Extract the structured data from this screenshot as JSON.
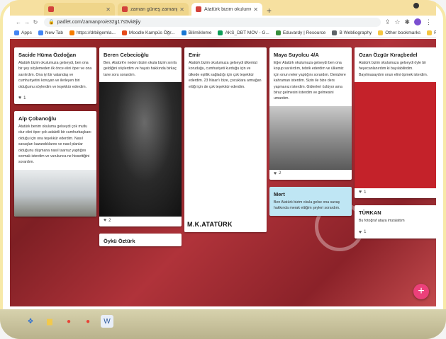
{
  "browser": {
    "tabs": [
      {
        "label": "",
        "active": false,
        "color": "#d2413b"
      },
      {
        "label": "zaman güneş zamanpro",
        "active": false,
        "color": "#d2413b"
      },
      {
        "label": "Atatürk bizim okulumuza gele...",
        "active": true,
        "color": "#d2413b"
      }
    ],
    "new_tab": "+",
    "url": "padlet.com/zamanpro/e32g17s5vk8jiy",
    "bookmarks": [
      {
        "label": "Apps",
        "color": "#4285f4"
      },
      {
        "label": "New Tab",
        "color": "#4285f4"
      },
      {
        "label": "https://drbilgemla...",
        "color": "#f57c00"
      },
      {
        "label": "Moodle Kampüs Öğr...",
        "color": "#e64a19"
      },
      {
        "label": "Bilimikleme",
        "color": "#1976d2"
      },
      {
        "label": "AKS_DBT MOV - G...",
        "color": "#0f9d58"
      },
      {
        "label": "Eduvardy | Resource",
        "color": "#388e3c"
      },
      {
        "label": "B Webliography",
        "color": "#5f6368"
      }
    ],
    "bookmarks_right": [
      "Other bookmarks",
      "Reading list"
    ]
  },
  "wall": {
    "columns": [
      {
        "cards": [
          {
            "name": "Sacide Hüma Özdoğan",
            "body": "Atatürk bizim okulumuza gelseydi, ben ona bir şey söylemeden ilk önce elini öper ve ona sarılırdım. Ona iyi bir vatandaş ve cumhuriyetini koruyan ve ilerleyen biri olduğumu söylerdim ve teşekkür ederdim.",
            "likes": "1",
            "photo": "",
            "caption": ""
          },
          {
            "name": "Alp Çobanoğlu",
            "body": "Atatürk benim okuluma gelseydi çok mutlu olur elini öper çok adaletli bir cumhurbaşkanı olduğu için ona teşekkür ederdim. Nasıl savaşları kazandıklarını ve nasıl planlar olduğunu düşmana nasıl taarruz yaptığını sormak isterdim ve vurulunca ne hissettiğini sorardım.",
            "likes": "",
            "photo": "war",
            "caption": ""
          }
        ]
      },
      {
        "cards": [
          {
            "name": "Beren Cebecioğlu",
            "body": "Ben, Atatürk'e neden bizim okula bizim sınıfa geldiğini söylerdim ve hayatı hakkında birkaç tane soru sorardım.",
            "likes": "2",
            "photo": "dark",
            "caption": ""
          },
          {
            "name": "Öykü Öztürk",
            "body": "",
            "likes": "",
            "photo": "",
            "caption": ""
          }
        ]
      },
      {
        "cards": [
          {
            "name": "Emir",
            "body": "Atatürk bizim okulumuza gelseydi ülkemizi koruduğu, cumhuriyeti kurduğu için ve ülkede eşitlik sağladığı için çok teşekkür ederdim. 23 Nisan'ı bize, çocuklara armağan ettiği için de çok teşekkür ederdim.",
            "likes": "",
            "photo": "white",
            "caption": "M.K.ATATÜRK"
          }
        ]
      },
      {
        "cards": [
          {
            "name": "Maya Suyolcu 4/A",
            "body": "Eğer Atatürk okulumuza gelseydi ben ona koşup sarılırdım, tebrik ederdim ve ülkemiz için onun neler yaptığını sorardım. Denizlere kahraman isterdim. Sizin ile bize ders yapmanızı isterdim. Gidenleri özlüyor ama biraz gelmesini isterdim ve gelmesini umardım.",
            "likes": "2",
            "photo": "sepia",
            "caption": ""
          },
          {
            "name": "Mert",
            "body": "Ben Atatürk bizim okula gelse ona savaş hakkında merak ettiğim şeyleri sorardım.",
            "likes": "",
            "photo": "",
            "caption": "",
            "blue": true
          }
        ]
      },
      {
        "cards": [
          {
            "name": "Ozan Özgür Kıraçbedel",
            "body": "Atatürk bizim okulumuza gelseydi öyle bir heyecanlanırdım ki bayılabilirdim. Bayılmasaydım onun elini öpmek isterdim.",
            "likes": "1",
            "photo": "red",
            "caption": ""
          },
          {
            "name": "TÜRKAN",
            "body": "Bu fotoğraf ataya imzalattım",
            "likes": "1",
            "photo": "",
            "caption": ""
          }
        ]
      }
    ],
    "add_button": "+"
  },
  "taskbar": {
    "icons": [
      {
        "name": "windows",
        "glyph": "❖",
        "color": "#2d6fd2"
      },
      {
        "name": "file-explorer",
        "glyph": "▆",
        "color": "#f2c94c"
      },
      {
        "name": "chrome",
        "glyph": "●",
        "color": "#e94235"
      },
      {
        "name": "chrome-2",
        "glyph": "●",
        "color": "#e94235"
      },
      {
        "name": "word",
        "glyph": "W",
        "color": "#2b579a"
      }
    ]
  }
}
